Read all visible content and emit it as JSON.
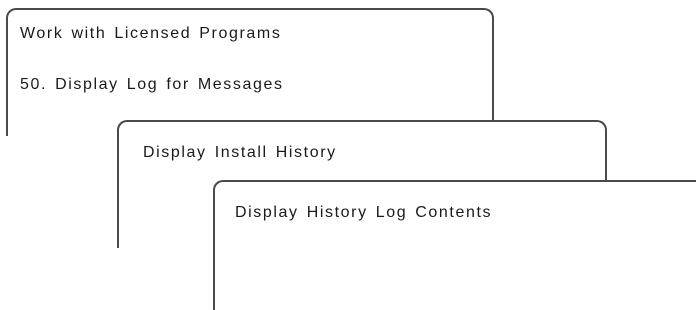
{
  "panels": [
    {
      "lines": [
        "Work with Licensed Programs",
        "50. Display Log for Messages"
      ]
    },
    {
      "lines": [
        "Display Install History"
      ]
    },
    {
      "lines": [
        "Display History Log Contents"
      ]
    }
  ]
}
